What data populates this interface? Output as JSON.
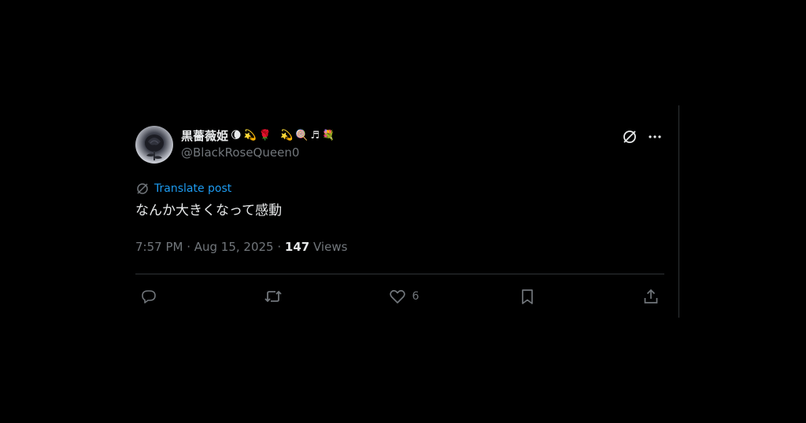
{
  "post": {
    "author": {
      "display_name": "黒薔薇姫",
      "name_emojis": [
        "🌘",
        "💫",
        "🌹",
        "💫",
        "🍭",
        "♬",
        "💐"
      ],
      "handle": "@BlackRoseQueen0",
      "avatar_icon": "black-rose-avatar"
    },
    "translate_label": "Translate post",
    "text": "なんか大きくなって感動",
    "timestamp": "7:57 PM · Aug 15, 2025 · ",
    "views_count": "147",
    "views_label": " Views",
    "actions": {
      "reply_count": "",
      "repost_count": "",
      "like_count": "6",
      "bookmark_count": ""
    }
  },
  "colors": {
    "background": "#000000",
    "text_primary": "#e7e9ea",
    "text_secondary": "#71767b",
    "accent": "#1d9bf0",
    "divider": "#2f3336"
  }
}
